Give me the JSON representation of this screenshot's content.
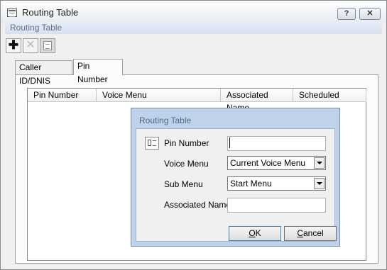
{
  "window": {
    "title": "Routing Table",
    "help_glyph": "?",
    "close_glyph": "✕"
  },
  "header": {
    "subtitle": "Routing Table"
  },
  "toolbar": {
    "add_glyph": "✚",
    "delete_glyph": "✕"
  },
  "tabs": [
    {
      "label": "Caller ID/DNIS",
      "selected": false
    },
    {
      "label": "Pin Number",
      "selected": true
    }
  ],
  "table": {
    "columns": [
      "Pin Number",
      "Voice Menu",
      "Associated Name",
      "Scheduled"
    ],
    "rows": []
  },
  "dialog": {
    "title": "Routing Table",
    "fields": {
      "pin_number_label": "Pin Number",
      "pin_number_value": "",
      "voice_menu_label": "Voice Menu",
      "voice_menu_value": "Current Voice Menu",
      "sub_menu_label": "Sub Menu",
      "sub_menu_value": "Start Menu",
      "associated_name_label": "Associated Name",
      "associated_name_value": ""
    },
    "ok_accel": "O",
    "ok_rest": "K",
    "cancel_accel": "C",
    "cancel_rest": "ancel"
  },
  "colors": {
    "dialog_border": "#6f8fb8",
    "subheader_text": "#5b6f8c"
  }
}
